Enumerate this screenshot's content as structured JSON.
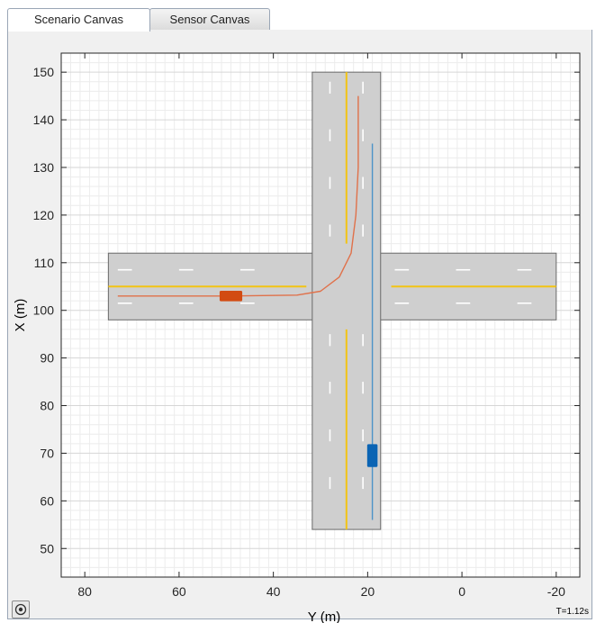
{
  "tabs": [
    {
      "label": "Scenario Canvas",
      "active": true
    },
    {
      "label": "Sensor Canvas",
      "active": false
    }
  ],
  "status": {
    "time": "T=1.12s"
  },
  "chart_data": {
    "type": "scenario-plot",
    "xlabel": "Y (m)",
    "ylabel": "X (m)",
    "xlim": [
      -25,
      85
    ],
    "ylim": [
      44,
      154
    ],
    "x_reversed": true,
    "grid": true,
    "x_ticks": [
      80,
      60,
      40,
      20,
      0,
      -20
    ],
    "y_ticks": [
      50,
      60,
      70,
      80,
      90,
      100,
      110,
      120,
      130,
      140,
      150
    ],
    "roads": [
      {
        "name": "east-west-road",
        "y_from": 75,
        "y_to": -20,
        "x_center": 105,
        "width": 14
      },
      {
        "name": "north-south-road",
        "y_center": 24.5,
        "x_from": 54,
        "x_to": 150,
        "width": 14.5
      }
    ],
    "center_lines": {
      "color": "#f2c414",
      "segments": [
        {
          "name": "centerline-west",
          "points": [
            [
              75,
              105
            ],
            [
              33,
              105
            ]
          ]
        },
        {
          "name": "centerline-east",
          "points": [
            [
              15,
              105
            ],
            [
              -20,
              105
            ]
          ]
        },
        {
          "name": "centerline-north",
          "points": [
            [
              24.5,
              150
            ],
            [
              24.5,
              114
            ]
          ]
        },
        {
          "name": "centerline-south",
          "points": [
            [
              24.5,
              96
            ],
            [
              24.5,
              54
            ]
          ]
        }
      ]
    },
    "vehicles": [
      {
        "name": "ego-vehicle-orange",
        "color": "#d24b12",
        "y": 49,
        "x": 103,
        "length": 4.8,
        "width": 2.2,
        "orientation": "horizontal"
      },
      {
        "name": "vehicle-blue",
        "color": "#0a64b4",
        "y": 19,
        "x": 69.5,
        "length": 4.8,
        "width": 2.2,
        "orientation": "vertical"
      }
    ],
    "trajectories": [
      {
        "name": "orange-trajectory",
        "color": "#e0714a",
        "points": [
          [
            73,
            103
          ],
          [
            50,
            103
          ],
          [
            35,
            103.2
          ],
          [
            30,
            104
          ],
          [
            26,
            107
          ],
          [
            23.5,
            112
          ],
          [
            22.5,
            120
          ],
          [
            22,
            130
          ],
          [
            22,
            145
          ]
        ]
      },
      {
        "name": "blue-trajectory",
        "color": "#4b93c8",
        "points": [
          [
            19,
            56
          ],
          [
            19,
            135
          ]
        ]
      }
    ],
    "road_color": "#cfcfcf",
    "lane_mark_color": "#ffffff"
  }
}
